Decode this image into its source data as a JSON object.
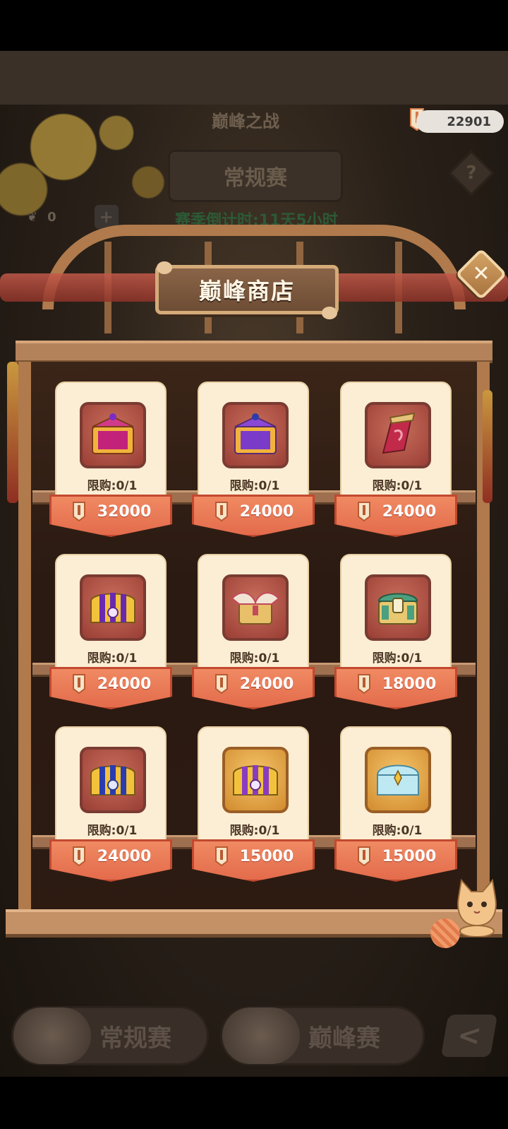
{
  "background": {
    "title": "巅峰之战",
    "mode_label": "常规赛",
    "countdown": "赛季倒计时:11天5小时",
    "item_count": "0",
    "help": "?"
  },
  "currency": {
    "amount": "22901",
    "icon": "brush-token-icon"
  },
  "shop": {
    "title": "巅峰商店",
    "close": "✕",
    "items": [
      {
        "limit": "限购:0/1",
        "price": "32000",
        "icon": "chest-magenta-icon"
      },
      {
        "limit": "限购:0/1",
        "price": "24000",
        "icon": "chest-purple-icon"
      },
      {
        "limit": "限购:0/1",
        "price": "24000",
        "icon": "scroll-staff-icon"
      },
      {
        "limit": "限购:0/1",
        "price": "24000",
        "icon": "ornate-chest-purple-icon"
      },
      {
        "limit": "限购:0/1",
        "price": "24000",
        "icon": "winged-chest-icon"
      },
      {
        "limit": "限购:0/1",
        "price": "18000",
        "icon": "jade-chest-icon"
      },
      {
        "limit": "限购:0/1",
        "price": "24000",
        "icon": "ornate-chest-blue-icon"
      },
      {
        "limit": "限购:0/1",
        "price": "15000",
        "icon": "ornate-chest-gold-icon"
      },
      {
        "limit": "限购:0/1",
        "price": "15000",
        "icon": "ice-chest-icon"
      }
    ]
  },
  "tabs": [
    {
      "label": "常规赛"
    },
    {
      "label": "巅峰赛"
    }
  ],
  "colors": {
    "price_tag": "#e36b4b",
    "card": "#fbeed4",
    "frame": "#b07a4c"
  }
}
